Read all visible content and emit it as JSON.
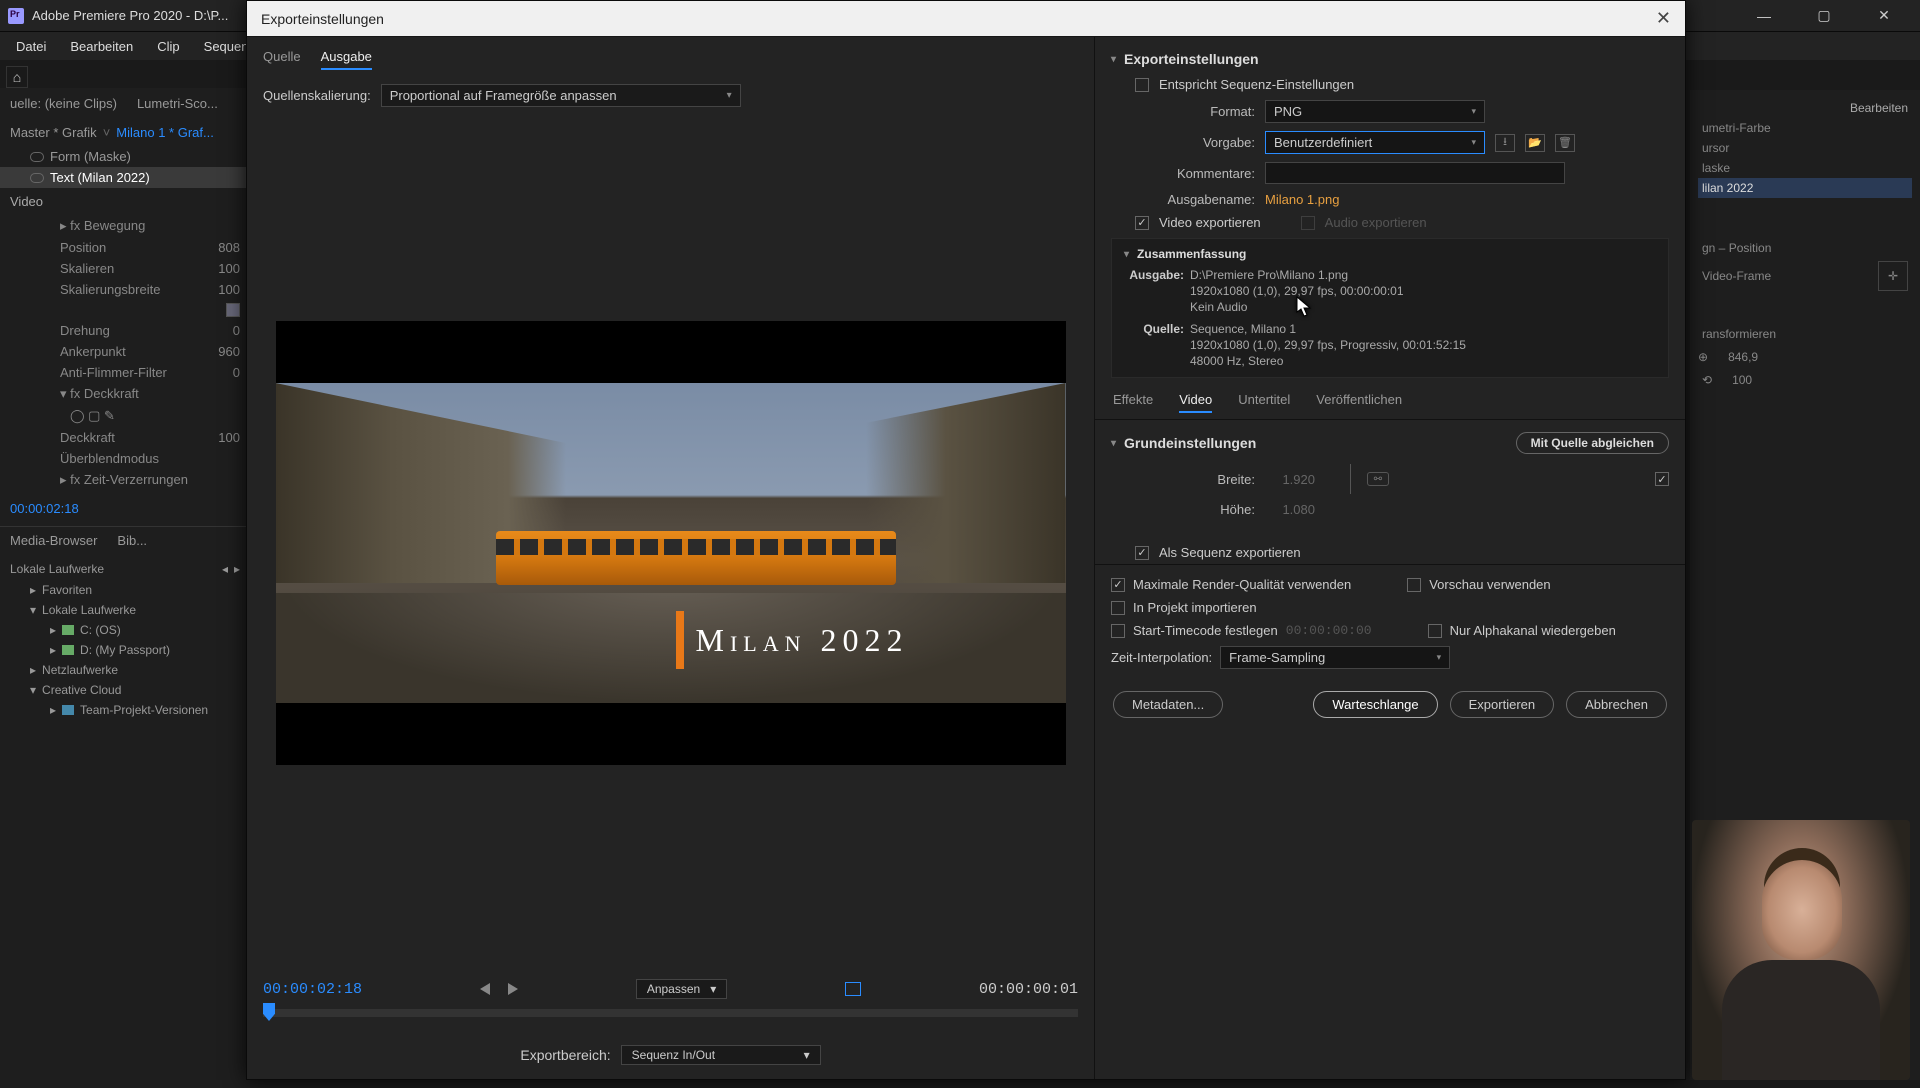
{
  "titlebar": {
    "title": "Adobe Premiere Pro 2020 - D:\\P..."
  },
  "menubar": [
    "Datei",
    "Bearbeiten",
    "Clip",
    "Sequen..."
  ],
  "left": {
    "source_tabs": [
      "uelle: (keine Clips)",
      "Lumetri-Sco..."
    ],
    "master_left": "Master * Grafik",
    "master_right": "Milano 1 * Graf...",
    "tree": {
      "form": "Form (Maske)",
      "text": "Text (Milan 2022)"
    },
    "video_header": "Video",
    "props": {
      "bewegung": "Bewegung",
      "position": {
        "lbl": "Position",
        "val": "808"
      },
      "skalieren": {
        "lbl": "Skalieren",
        "val": "100"
      },
      "skalierungsbreite": {
        "lbl": "Skalierungsbreite",
        "val": "100"
      },
      "drehung": {
        "lbl": "Drehung",
        "val": "0"
      },
      "ankerpunkt": {
        "lbl": "Ankerpunkt",
        "val": "960"
      },
      "antiflimmer": {
        "lbl": "Anti-Flimmer-Filter",
        "val": "0"
      },
      "deckkraft": "Deckkraft",
      "deckkraft2": {
        "lbl": "Deckkraft",
        "val": "100"
      },
      "ueberblend": "Überblendmodus",
      "zeitverz": "Zeit-Verzerrungen"
    },
    "timecode": "00:00:02:18",
    "browser_tabs": [
      "Media-Browser",
      "Bib..."
    ],
    "drive_header": "Lokale Laufwerke",
    "favorites": "Favoriten",
    "local": "Lokale Laufwerke",
    "c": "C: (OS)",
    "d": "D: (My Passport)",
    "net": "Netzlaufwerke",
    "cc": "Creative Cloud",
    "team": "Team-Projekt-Versionen"
  },
  "dialog": {
    "title": "Exporteinstellungen",
    "close_tip": "Schließen",
    "tabs_src": "Quelle",
    "tabs_out": "Ausgabe",
    "scaling_lbl": "Quellenskalierung:",
    "scaling_val": "Proportional auf Framegröße anpassen",
    "preview_title": "Milan 2022",
    "tc_left": "00:00:02:18",
    "fit": "Anpassen",
    "tc_right": "00:00:00:01",
    "range_lbl": "Exportbereich:",
    "range_val": "Sequenz In/Out",
    "right": {
      "head": "Exporteinstellungen",
      "match_seq": "Entspricht Sequenz-Einstellungen",
      "format_lbl": "Format:",
      "format_val": "PNG",
      "preset_lbl": "Vorgabe:",
      "preset_val": "Benutzerdefiniert",
      "comment_lbl": "Kommentare:",
      "outname_lbl": "Ausgabename:",
      "outname_val": "Milano 1.png",
      "vid_export": "Video exportieren",
      "aud_export": "Audio exportieren",
      "summary_head": "Zusammenfassung",
      "out_lbl": "Ausgabe:",
      "out_l1": "D:\\Premiere Pro\\Milano 1.png",
      "out_l2": "1920x1080 (1,0), 29,97 fps, 00:00:00:01",
      "out_l3": "Kein Audio",
      "src_lbl": "Quelle:",
      "src_l1": "Sequence, Milano 1",
      "src_l2": "1920x1080 (1,0), 29,97 fps, Progressiv, 00:01:52:15",
      "src_l3": "48000 Hz, Stereo",
      "tabs": {
        "effekte": "Effekte",
        "video": "Video",
        "unter": "Untertitel",
        "pub": "Veröffentlichen"
      },
      "basic_head": "Grundeinstellungen",
      "match_src": "Mit Quelle abgleichen",
      "width_lbl": "Breite:",
      "width_val": "1.920",
      "height_lbl": "Höhe:",
      "height_val": "1.080",
      "as_seq": "Als Sequenz exportieren",
      "max_render": "Maximale Render-Qualität verwenden",
      "preview": "Vorschau verwenden",
      "import_proj": "In Projekt importieren",
      "start_tc": "Start-Timecode festlegen",
      "start_tc_val": "00:00:00:00",
      "alpha": "Nur Alphakanal wiedergeben",
      "time_interp_lbl": "Zeit-Interpolation:",
      "time_interp_val": "Frame-Sampling",
      "btn_meta": "Metadaten...",
      "btn_queue": "Warteschlange",
      "btn_export": "Exportieren",
      "btn_cancel": "Abbrechen"
    }
  },
  "right_host": {
    "tabs": "Bearbeiten",
    "lumetri": "umetri-Farbe",
    "cursor": "ursor",
    "maske": "laske",
    "milan": "lilan 2022",
    "pos": "gn – Position",
    "vframe": "Video-Frame",
    "trans": "ransformieren",
    "v846": "846,9",
    "v100": "100"
  }
}
